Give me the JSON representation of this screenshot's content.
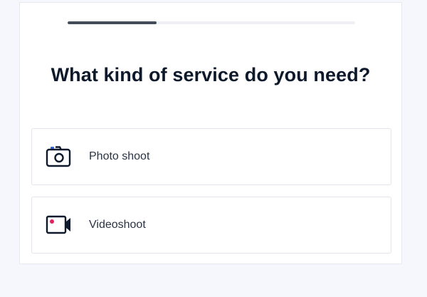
{
  "progress": {
    "fraction": 0.31,
    "fill_color": "#444c5a",
    "track_color": "#efeff6"
  },
  "question": {
    "title": "What kind of service do you need?"
  },
  "options": [
    {
      "label": "Photo shoot",
      "icon": "camera-icon",
      "accent_color": "#2b63e0"
    },
    {
      "label": "Videoshoot",
      "icon": "video-camera-icon",
      "accent_color": "#e0245e"
    }
  ]
}
